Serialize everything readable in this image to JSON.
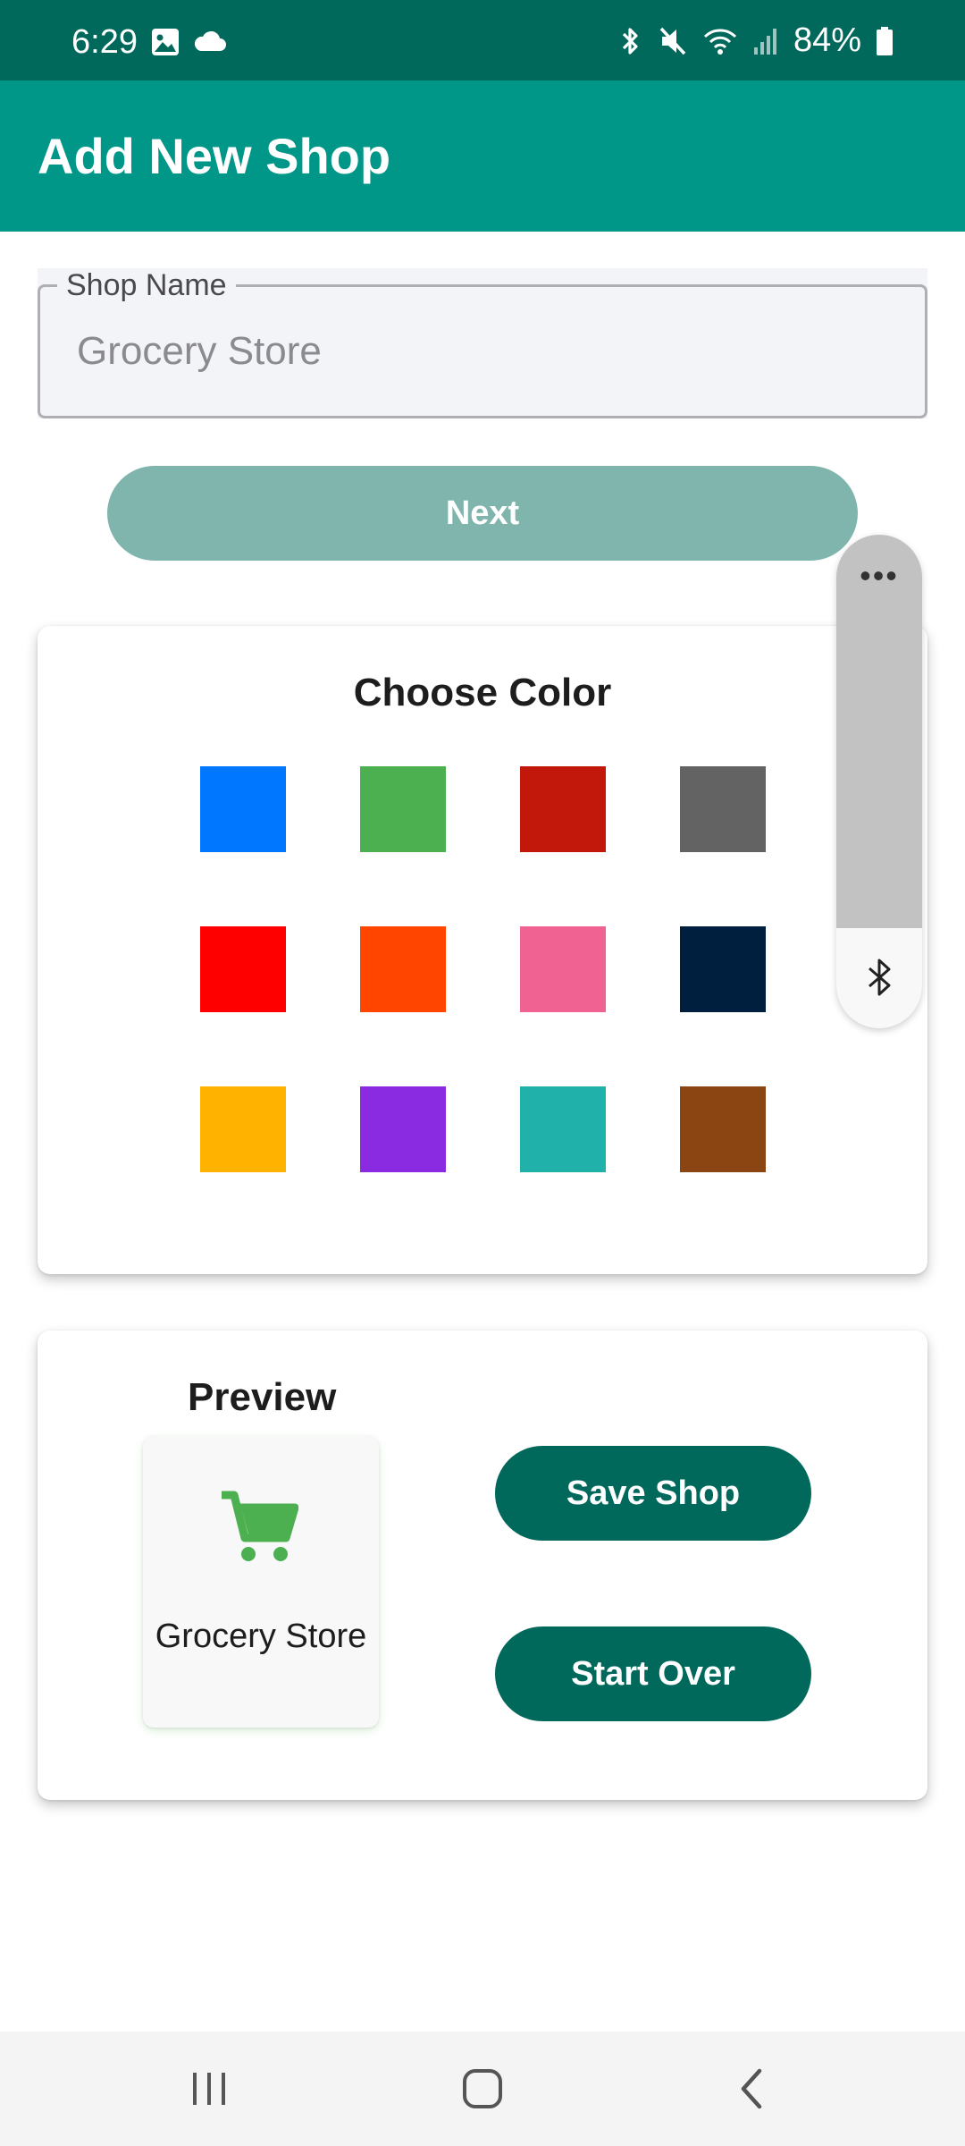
{
  "status_bar": {
    "time": "6:29",
    "battery": "84%",
    "left_icons": [
      "image-icon",
      "cloud-icon"
    ],
    "right_icons": [
      "bluetooth-icon",
      "mute-icon",
      "wifi-icon",
      "signal-icon",
      "battery-icon"
    ]
  },
  "app_bar": {
    "title": "Add New Shop"
  },
  "form": {
    "shop_name_label": "Shop Name",
    "shop_name_value": "Grocery Store",
    "next_label": "Next"
  },
  "color_picker": {
    "title": "Choose Color",
    "colors": [
      "#0077ff",
      "#4caf50",
      "#c2180b",
      "#636363",
      "#ff0000",
      "#ff4500",
      "#f06292",
      "#001f3f",
      "#ffb300",
      "#8a2be2",
      "#20b2aa",
      "#8b4513"
    ]
  },
  "preview": {
    "title": "Preview",
    "shop_name": "Grocery Store",
    "icon": "shopping-cart-icon",
    "icon_color": "#4caf50",
    "save_label": "Save Shop",
    "start_over_label": "Start Over"
  },
  "floating_panel": {
    "more_label": "•••",
    "icon": "bluetooth-icon"
  },
  "nav_bar": {
    "buttons": [
      "recent-apps-icon",
      "home-icon",
      "back-icon"
    ]
  },
  "theme": {
    "primary": "#009688",
    "primary_dark": "#00695c",
    "next_disabled": "#80b5ad"
  }
}
